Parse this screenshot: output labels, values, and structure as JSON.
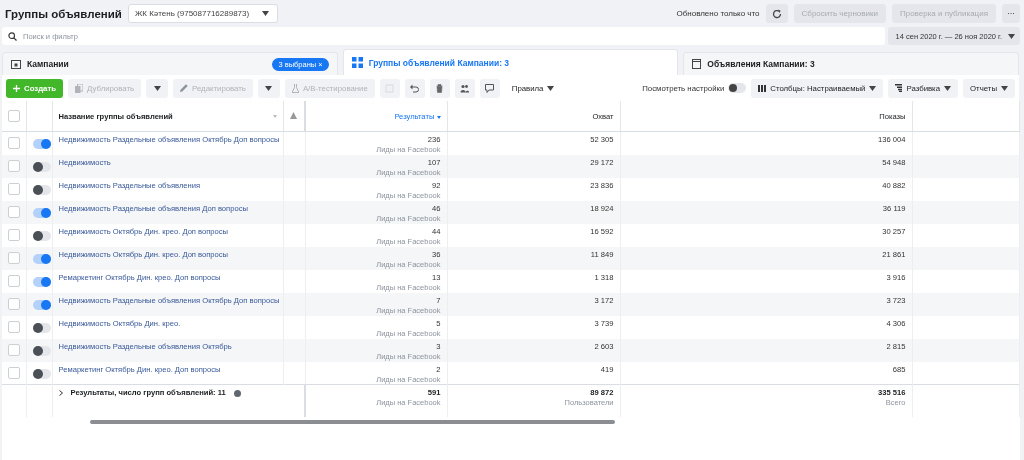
{
  "header": {
    "title": "Группы объявлений",
    "account": "ЖК Кәтень (975087716289873)",
    "updated": "Обновлено только что",
    "discard": {
      "label": "Сбросить черновики",
      "disabled": true
    },
    "publish": {
      "label": "Проверка и публикация",
      "disabled": true
    },
    "more": "···"
  },
  "search": {
    "placeholder": "Поиск и фильтр",
    "date_range": "14 сен 2020 г. — 26 ноя 2020 г."
  },
  "tabs": [
    {
      "label": "Кампании",
      "selected": false,
      "badge": "3 выбраны ×"
    },
    {
      "label": "Группы объявлений Кампании: 3",
      "selected": true
    },
    {
      "label": "Объявления Кампании: 3",
      "selected": false
    }
  ],
  "toolbar": {
    "create": {
      "label": "Создать"
    },
    "duplicate": {
      "label": "Дублировать",
      "disabled": true
    },
    "edit": {
      "label": "Редактировать",
      "disabled": true
    },
    "ab_test": {
      "label": "A/B-тестирование",
      "disabled": true
    },
    "rules": {
      "label": "Правила"
    },
    "view_settings": {
      "label": "Посмотреть настройки",
      "on": false
    },
    "columns": {
      "label": "Столбцы: Настраиваемый"
    },
    "breakdown": {
      "label": "Разбивка"
    },
    "reports": {
      "label": "Отчеты"
    }
  },
  "table": {
    "select_all_checked": false,
    "columns": {
      "name": "Название группы объявлений",
      "results": "Результаты",
      "reach": "Охват",
      "impressions": "Показы"
    },
    "rows": [
      {
        "checked": false,
        "on": true,
        "name": "Недвижимость Раздельные объявления Октябрь Доп вопросы",
        "results": "236",
        "results_label": "Лиды на Facebook",
        "reach": "52 305",
        "impressions": "136 004"
      },
      {
        "checked": false,
        "on": false,
        "name": "Недвижимость",
        "results": "107",
        "results_label": "Лиды на Facebook",
        "reach": "29 172",
        "impressions": "54 948"
      },
      {
        "checked": false,
        "on": false,
        "name": "Недвижимость Раздельные объявления",
        "results": "92",
        "results_label": "Лиды на Facebook",
        "reach": "23 836",
        "impressions": "40 882"
      },
      {
        "checked": false,
        "on": true,
        "name": "Недвижимость Раздельные объявления Доп вопросы",
        "results": "46",
        "results_label": "Лиды на Facebook",
        "reach": "18 924",
        "impressions": "36 119"
      },
      {
        "checked": false,
        "on": false,
        "name": "Недвижимость Октябрь Дин. крео. Доп вопросы",
        "results": "44",
        "results_label": "Лиды на Facebook",
        "reach": "16 592",
        "impressions": "30 257"
      },
      {
        "checked": false,
        "on": true,
        "name": "Недвижимость Октябрь Дин. крео. Доп вопросы",
        "results": "36",
        "results_label": "Лиды на Facebook",
        "reach": "11 849",
        "impressions": "21 861"
      },
      {
        "checked": false,
        "on": true,
        "name": "Ремаркетинг Октябрь Дин. крео. Доп вопросы",
        "results": "13",
        "results_label": "Лиды на Facebook",
        "reach": "1 318",
        "impressions": "3 916"
      },
      {
        "checked": false,
        "on": true,
        "name": "Недвижимость Раздельные объявления Октябрь Доп вопросы",
        "results": "7",
        "results_label": "Лиды на Facebook",
        "reach": "3 172",
        "impressions": "3 723"
      },
      {
        "checked": false,
        "on": false,
        "name": "Недвижимость Октябрь Дин. крео.",
        "results": "5",
        "results_label": "Лиды на Facebook",
        "reach": "3 739",
        "impressions": "4 306"
      },
      {
        "checked": false,
        "on": false,
        "name": "Недвижимость Раздельные объявления Октябрь",
        "results": "3",
        "results_label": "Лиды на Facebook",
        "reach": "2 603",
        "impressions": "2 815"
      },
      {
        "checked": false,
        "on": false,
        "name": "Ремаркетинг Октябрь Дин. крео. Доп вопросы",
        "results": "2",
        "results_label": "Лиды на Facebook",
        "reach": "419",
        "impressions": "685"
      }
    ],
    "footer": {
      "label": "Результаты, число групп объявлений: 11",
      "results": "591",
      "results_label": "Лиды на Facebook",
      "reach": "89 872",
      "reach_label": "Пользователи",
      "impressions": "335 516",
      "impressions_label": "Всего"
    }
  }
}
